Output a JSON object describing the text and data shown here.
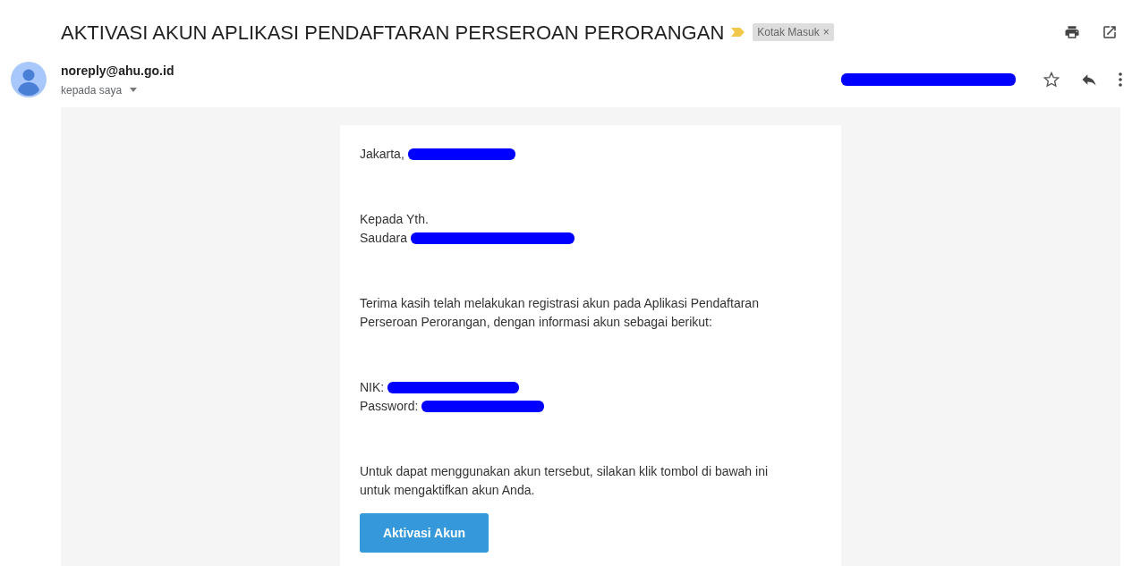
{
  "subject": "AKTIVASI AKUN APLIKASI PENDAFTARAN PERSEROAN PERORANGAN",
  "important": true,
  "label": {
    "text": "Kotak Masuk",
    "close": "×"
  },
  "sender": {
    "email": "noreply@ahu.go.id",
    "recipient": "kepada saya",
    "date_redacted": true
  },
  "letter": {
    "paragraphs": [
      {
        "lines": [
          {
            "text": "Jakarta,",
            "redacted": true
          }
        ]
      },
      {
        "lines": [
          {
            "text": "Kepada Yth.",
            "redacted": false
          },
          {
            "text": "Saudara",
            "redacted": true
          }
        ]
      },
      {
        "lines": [
          {
            "text": "Terima kasih telah melakukan registrasi akun pada Aplikasi Pendaftaran Perseroan Perorangan, dengan informasi akun sebagai berikut:",
            "redacted": false
          }
        ]
      },
      {
        "lines": [
          {
            "text": "NIK:",
            "redacted": true
          },
          {
            "text": "Password:",
            "redacted": true
          }
        ]
      },
      {
        "lines": [
          {
            "text": "Untuk dapat menggunakan akun tersebut, silakan klik tombol di bawah ini untuk mengaktifkan akun Anda.",
            "redacted": false
          }
        ]
      }
    ],
    "button": "Aktivasi Akun"
  }
}
